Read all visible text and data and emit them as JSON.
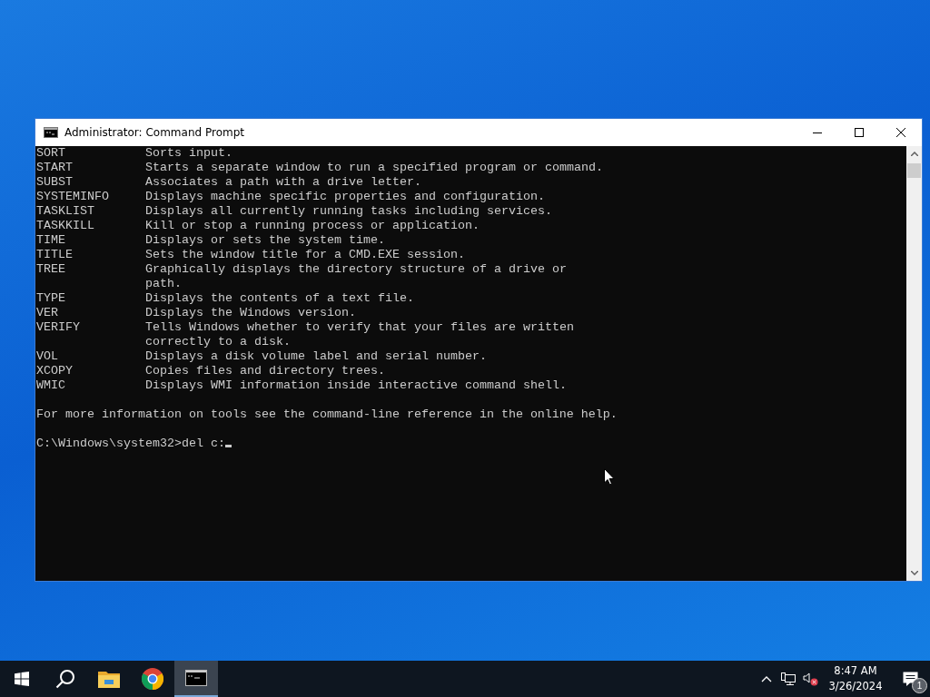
{
  "window": {
    "title": "Administrator: Command Prompt"
  },
  "console": {
    "entries": [
      {
        "command": "SORT",
        "description": [
          "Sorts input."
        ]
      },
      {
        "command": "START",
        "description": [
          "Starts a separate window to run a specified program or command."
        ]
      },
      {
        "command": "SUBST",
        "description": [
          "Associates a path with a drive letter."
        ]
      },
      {
        "command": "SYSTEMINFO",
        "description": [
          "Displays machine specific properties and configuration."
        ]
      },
      {
        "command": "TASKLIST",
        "description": [
          "Displays all currently running tasks including services."
        ]
      },
      {
        "command": "TASKKILL",
        "description": [
          "Kill or stop a running process or application."
        ]
      },
      {
        "command": "TIME",
        "description": [
          "Displays or sets the system time."
        ]
      },
      {
        "command": "TITLE",
        "description": [
          "Sets the window title for a CMD.EXE session."
        ]
      },
      {
        "command": "TREE",
        "description": [
          "Graphically displays the directory structure of a drive or",
          "path."
        ]
      },
      {
        "command": "TYPE",
        "description": [
          "Displays the contents of a text file."
        ]
      },
      {
        "command": "VER",
        "description": [
          "Displays the Windows version."
        ]
      },
      {
        "command": "VERIFY",
        "description": [
          "Tells Windows whether to verify that your files are written",
          "correctly to a disk."
        ]
      },
      {
        "command": "VOL",
        "description": [
          "Displays a disk volume label and serial number."
        ]
      },
      {
        "command": "XCOPY",
        "description": [
          "Copies files and directory trees."
        ]
      },
      {
        "command": "WMIC",
        "description": [
          "Displays WMI information inside interactive command shell."
        ]
      }
    ],
    "footer": "For more information on tools see the command-line reference in the online help.",
    "prompt": "C:\\Windows\\system32>",
    "input": "del c:"
  },
  "taskbar": {
    "apps": [
      {
        "kind": "start",
        "selected": false
      },
      {
        "kind": "search",
        "selected": false
      },
      {
        "kind": "explorer",
        "selected": false
      },
      {
        "kind": "browser",
        "selected": false
      },
      {
        "kind": "terminal",
        "selected": true
      }
    ],
    "time": "8:47 AM",
    "date": "3/26/2024",
    "notifications": "1"
  }
}
